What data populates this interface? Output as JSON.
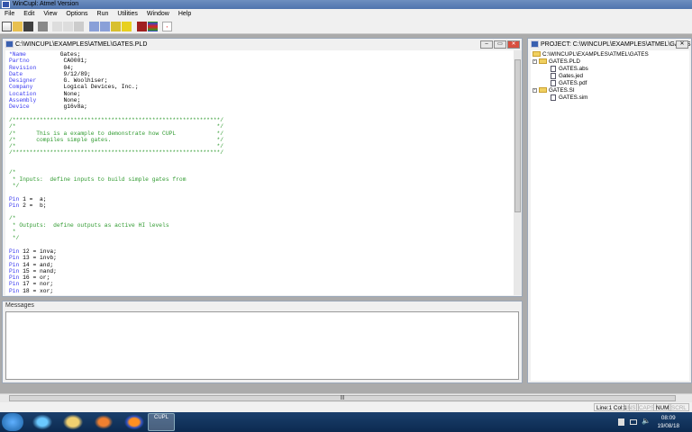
{
  "app": {
    "title": "WinCupl: Atmel Version"
  },
  "menu": [
    "File",
    "Edit",
    "View",
    "Options",
    "Run",
    "Utilities",
    "Window",
    "Help"
  ],
  "editor": {
    "title": "C:\\WINCUPL\\EXAMPLES\\ATMEL\\GATES.PLD",
    "lines": [
      {
        "k": "*Name",
        "t": "          Gates;"
      },
      {
        "k": "Partno",
        "t": "          CA0001;"
      },
      {
        "k": "Revision",
        "t": "        04;"
      },
      {
        "k": "Date",
        "t": "            9/12/89;"
      },
      {
        "k": "Designer",
        "t": "        G. Woolhiser;"
      },
      {
        "k": "Company",
        "t": "         Logical Devices, Inc.;"
      },
      {
        "k": "Location",
        "t": "        None;"
      },
      {
        "k": "Assembly",
        "t": "        None;"
      },
      {
        "k": "Device",
        "t": "          g16v8a;"
      },
      {},
      {
        "c": "/*************************************************************/"
      },
      {
        "c": "/*                                                           */"
      },
      {
        "c": "/*      This is a example to demonstrate how CUPL            */"
      },
      {
        "c": "/*      compiles simple gates.                               */"
      },
      {
        "c": "/*                                                           */"
      },
      {
        "c": "/*************************************************************/"
      },
      {},
      {},
      {
        "c": "/*"
      },
      {
        "c": " * Inputs:  define inputs to build simple gates from"
      },
      {
        "c": " */"
      },
      {},
      {
        "k": "Pin",
        "t": " 1 =  a;"
      },
      {
        "k": "Pin",
        "t": " 2 =  b;"
      },
      {},
      {
        "c": "/*"
      },
      {
        "c": " * Outputs:  define outputs as active HI levels"
      },
      {
        "c": " *"
      },
      {
        "c": " */"
      },
      {},
      {
        "k": "Pin",
        "t": " 12 = inva;"
      },
      {
        "k": "Pin",
        "t": " 13 = invb;"
      },
      {
        "k": "Pin",
        "t": " 14 = and;"
      },
      {
        "k": "Pin",
        "t": " 15 = nand;"
      },
      {
        "k": "Pin",
        "t": " 16 = or;"
      },
      {
        "k": "Pin",
        "t": " 17 = nor;"
      },
      {
        "k": "Pin",
        "t": " 18 = xor;"
      }
    ]
  },
  "messages": {
    "label": "Messages"
  },
  "project": {
    "title": "PROJECT: C:\\WINCUPL\\EXAMPLES\\ATMEL\\GATES",
    "root": "C:\\WINCUPL\\EXAMPLES\\ATMEL\\GATES",
    "groups": [
      {
        "name": "GATES.PLD",
        "files": [
          "GATES.abs",
          "Gates.jed",
          "GATES.pdf"
        ]
      },
      {
        "name": "GATES.SI",
        "files": [
          "GATES.sim"
        ]
      }
    ]
  },
  "status": {
    "position": "Line:1 Col:1",
    "ins": "INS",
    "caps": "CAPS",
    "num": "NUM",
    "scrl": "SCRL"
  },
  "taskbar": {
    "time": "08:09",
    "date": "19/08/18",
    "cupl_label": "CUPL"
  },
  "colors": {
    "keyword": "#3b3bf0",
    "comment": "#2f9a2f"
  }
}
